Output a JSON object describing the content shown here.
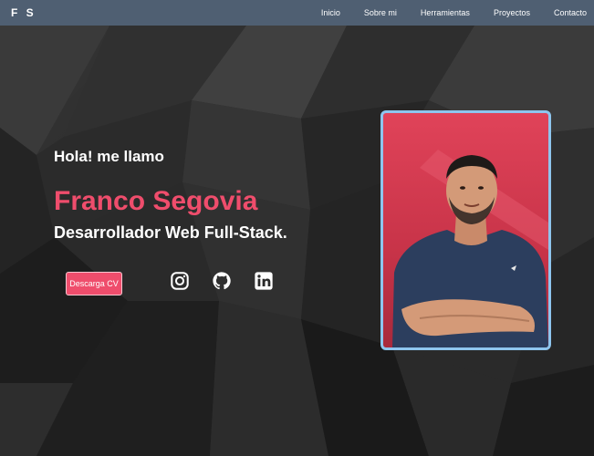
{
  "navbar": {
    "logo": "F S",
    "links": [
      "Inicio",
      "Sobre mi",
      "Herramientas",
      "Proyectos",
      "Contacto"
    ]
  },
  "hero": {
    "intro": "Hola! me llamo",
    "name": "Franco Segovia",
    "role": "Desarrollador Web Full-Stack.",
    "cv_button": "Descarga CV"
  },
  "socials": {
    "icons": [
      "instagram-icon",
      "github-icon",
      "linkedin-icon"
    ]
  },
  "colors": {
    "accent": "#ef4d6c",
    "navbar": "#4f5f72",
    "photo_border": "#8ec5ee"
  }
}
